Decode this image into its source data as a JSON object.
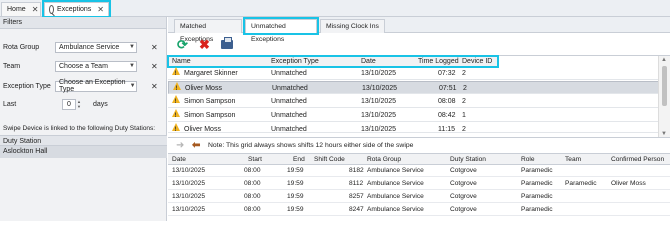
{
  "top_tabs": [
    {
      "label": "Home",
      "close": "✕"
    },
    {
      "label": "Exceptions",
      "close": "✕"
    }
  ],
  "filters": {
    "title": "Filters",
    "rota_group": {
      "label": "Rota Group",
      "value": "Ambulance Service"
    },
    "team": {
      "label": "Team",
      "value": "Choose a Team"
    },
    "exception_type": {
      "label": "Exception Type",
      "value": "Choose an Exception Type"
    },
    "last": {
      "label": "Last",
      "value": "0",
      "unit": "days"
    },
    "swipe_text": "Swipe Device is linked to the following Duty Stations:",
    "duty_station_header": "Duty Station",
    "duty_stations": [
      "Aslockton Hall"
    ]
  },
  "sub_tabs": [
    "Matched Exceptions",
    "Unmatched Exceptions",
    "Missing Clock Ins"
  ],
  "toolbar": {
    "refresh_icon": "refresh-icon",
    "delete_icon": "delete-icon",
    "print_icon": "printer-icon"
  },
  "exceptions": {
    "columns": [
      "Name",
      "Exception Type",
      "Date",
      "Time Logged",
      "Device ID"
    ],
    "rows": [
      {
        "name": "Margaret Skinner",
        "type": "Unmatched",
        "date": "13/10/2025",
        "time": "07:32",
        "device": "2"
      },
      {
        "name": "Oliver Moss",
        "type": "Unmatched",
        "date": "13/10/2025",
        "time": "07:51",
        "device": "2"
      },
      {
        "name": "Simon Sampson",
        "type": "Unmatched",
        "date": "13/10/2025",
        "time": "08:08",
        "device": "2"
      },
      {
        "name": "Simon Sampson",
        "type": "Unmatched",
        "date": "13/10/2025",
        "time": "08:42",
        "device": "1"
      },
      {
        "name": "Oliver Moss",
        "type": "Unmatched",
        "date": "13/10/2025",
        "time": "11:15",
        "device": "2"
      }
    ]
  },
  "note": "Note: This grid always shows shifts 12 hours either side of the swipe",
  "shifts": {
    "columns": [
      "Date",
      "Start",
      "End",
      "Shift Code",
      "Rota Group",
      "Duty Station",
      "Role",
      "Team",
      "Confirmed Person"
    ],
    "rows": [
      {
        "date": "13/10/2025",
        "start": "08:00",
        "end": "19:59",
        "code": "8182",
        "group": "Ambulance Service",
        "station": "Cotgrove",
        "role": "Paramedic",
        "team": "",
        "person": ""
      },
      {
        "date": "13/10/2025",
        "start": "08:00",
        "end": "19:59",
        "code": "8112",
        "group": "Ambulance Service",
        "station": "Cotgrove",
        "role": "Paramedic",
        "team": "Paramedic",
        "person": "Oliver Moss"
      },
      {
        "date": "13/10/2025",
        "start": "08:00",
        "end": "19:59",
        "code": "8257",
        "group": "Ambulance Service",
        "station": "Cotgrove",
        "role": "Paramedic",
        "team": "",
        "person": ""
      },
      {
        "date": "13/10/2025",
        "start": "08:00",
        "end": "19:59",
        "code": "8247",
        "group": "Ambulance Service",
        "station": "Cotgrove",
        "role": "Paramedic",
        "team": "",
        "person": ""
      }
    ]
  }
}
